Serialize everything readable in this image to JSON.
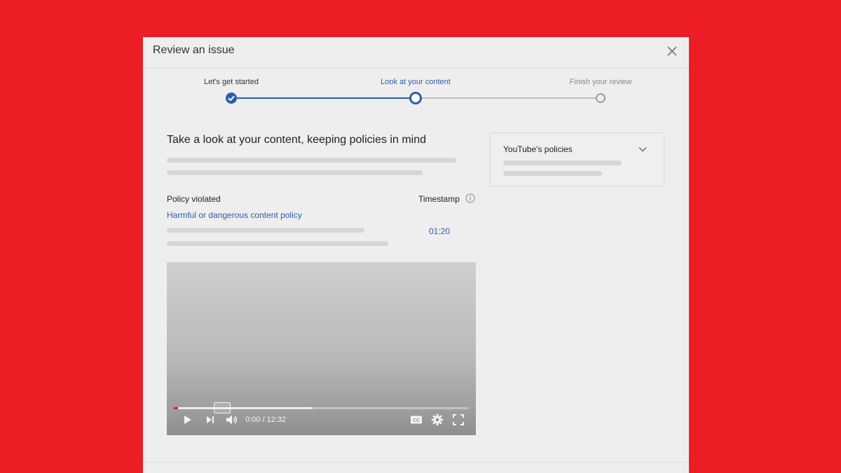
{
  "dialog": {
    "title": "Review an issue"
  },
  "stepper": {
    "steps": [
      {
        "label": "Let's get started",
        "state": "completed"
      },
      {
        "label": "Look at your content",
        "state": "current"
      },
      {
        "label": "Finish your review",
        "state": "upcoming"
      }
    ],
    "active_color": "#2a5db0",
    "inactive_color": "#9e9e9e"
  },
  "content": {
    "heading": "Take a look at your content, keeping policies in mind",
    "policy_label": "Policy violated",
    "policy_link": "Harmful or dangerous content policy",
    "timestamp_label": "Timestamp",
    "timestamp_value": "01:20"
  },
  "side_panel": {
    "title": "YouTube's policies"
  },
  "video": {
    "time_display": "0:00 / 12:32",
    "played_fraction": 0.0,
    "buffered_fraction": 0.47
  },
  "colors": {
    "background": "#ec1d25",
    "link": "#2a5db0",
    "progress": "#e62117"
  }
}
